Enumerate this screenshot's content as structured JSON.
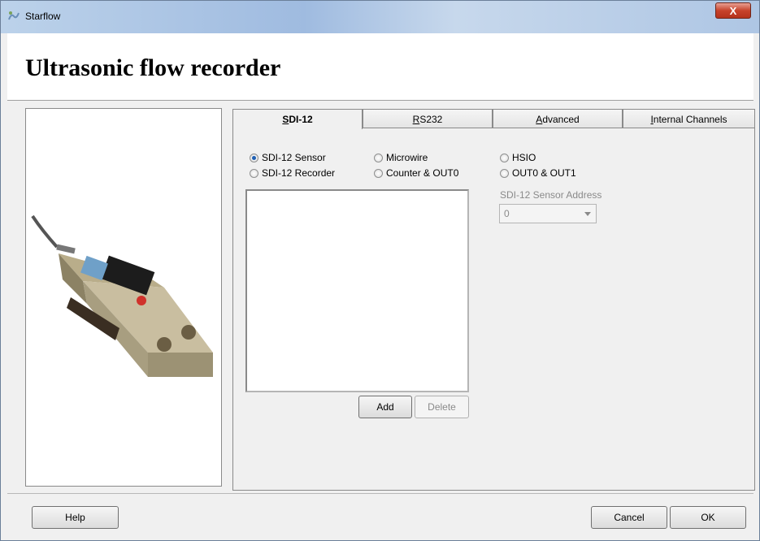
{
  "window": {
    "title": "Starflow",
    "close_label": "X"
  },
  "header": {
    "heading": "Ultrasonic flow recorder"
  },
  "tabs": [
    {
      "label": "SDI-12",
      "accel": "S",
      "rest": "DI-12"
    },
    {
      "label": "RS232",
      "accel": "R",
      "rest": "S232"
    },
    {
      "label": "Advanced",
      "accel": "A",
      "rest": "dvanced"
    },
    {
      "label": "Internal Channels",
      "accel": "I",
      "rest": "nternal Channels"
    }
  ],
  "mode_options": [
    {
      "label": "SDI-12 Sensor",
      "checked": true
    },
    {
      "label": "Microwire",
      "checked": false
    },
    {
      "label": "HSIO",
      "checked": false
    },
    {
      "label": "SDI-12 Recorder",
      "checked": false
    },
    {
      "label": "Counter  & OUT0",
      "checked": false
    },
    {
      "label": "OUT0 & OUT1",
      "checked": false
    }
  ],
  "sensor_address": {
    "label": "SDI-12 Sensor Address",
    "value": "0"
  },
  "list_buttons": {
    "add": "Add",
    "delete": "Delete"
  },
  "footer": {
    "help": "Help",
    "cancel": "Cancel",
    "ok": "OK"
  }
}
